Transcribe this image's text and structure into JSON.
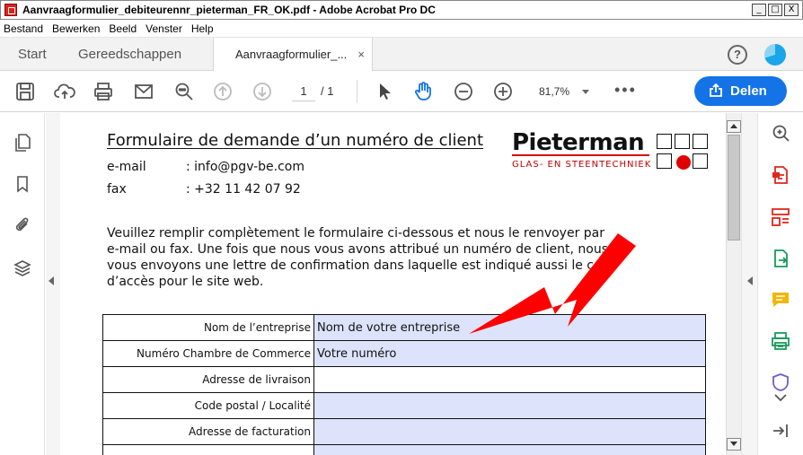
{
  "window": {
    "title": "Aanvraagformulier_debiteurennr_pieterman_FR_OK.pdf - Adobe Acrobat Pro DC",
    "controls": [
      "_",
      "□",
      "X"
    ]
  },
  "menu": [
    "Bestand",
    "Bewerken",
    "Beeld",
    "Venster",
    "Help"
  ],
  "tabs": {
    "start": "Start",
    "tools": "Gereedschappen",
    "document": "Aanvraagformulier_...",
    "close": "×"
  },
  "toolbar": {
    "page_current": "1",
    "page_total": "/ 1",
    "zoom": "81,7%",
    "more": "•••",
    "share_label": "Delen"
  },
  "icons": {
    "left_panel": [
      "pages-icon",
      "bookmark-icon",
      "attachment-icon",
      "layers-icon"
    ],
    "right_panel": [
      "zoom-search-icon",
      "export-pdf-icon",
      "organize-pages-icon",
      "send-file-icon",
      "comment-icon",
      "print-production-icon",
      "protect-icon",
      "collapse-panel-icon"
    ]
  },
  "document": {
    "title": "Formulaire de demande d’un numéro de client",
    "contacts": [
      {
        "label": "e-mail",
        "value": ": info@pgv-be.com"
      },
      {
        "label": "fax",
        "value": ": +32 11 42 07 92"
      }
    ],
    "intro": "Veuillez remplir complètement le formulaire ci-dessous et nous le renvoyer par e-mail ou fax. Une fois que nous vous avons attribué un numéro de client, nous vous envoyons une lettre de confirmation dans laquelle est indiqué aussi le code d’accès pour le site web.",
    "logo": {
      "name": "Pieterman",
      "subtitle": "GLAS- EN STEENTECHNIEK",
      "accent_color": "#e00000"
    },
    "form_rows": [
      {
        "label": "Nom de l’entreprise",
        "value": "Nom de votre entreprise"
      },
      {
        "label": "Numéro Chambre de Commerce",
        "value": "Votre numéro"
      },
      {
        "label": "Adresse de livraison",
        "value": ""
      },
      {
        "label": "Code postal / Localité",
        "value": ""
      },
      {
        "label": "Adresse de facturation",
        "value": ""
      }
    ]
  },
  "colors": {
    "share_button": "#1473e6",
    "field_fill": "#dde3fb",
    "annotation_arrow": "#ff0000"
  }
}
